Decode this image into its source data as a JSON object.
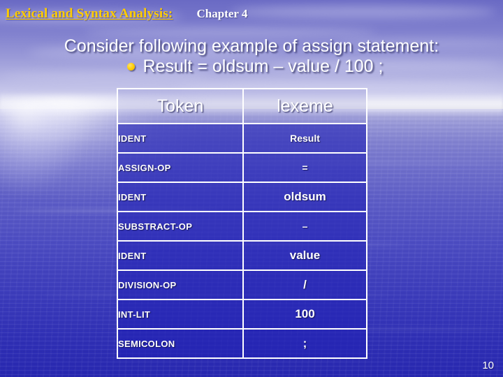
{
  "slide": {
    "header": {
      "title": "Lexical and Syntax Analysis:",
      "chapter": "Chapter 4"
    },
    "subtitle": "Consider following example of assign statement:",
    "bullet": {
      "icon": "bullet-dot-icon",
      "text": "Result = oldsum – value / 100 ;"
    },
    "table": {
      "columns": [
        "Token",
        "lexeme"
      ],
      "rows": [
        {
          "token": "IDENT",
          "lexeme": "Result",
          "lexeme_large": false
        },
        {
          "token": "ASSIGN-OP",
          "lexeme": "=",
          "lexeme_large": false
        },
        {
          "token": "IDENT",
          "lexeme": "oldsum",
          "lexeme_large": true
        },
        {
          "token": "SUBSTRACT-OP",
          "lexeme": "–",
          "lexeme_large": false
        },
        {
          "token": "IDENT",
          "lexeme": "value",
          "lexeme_large": true
        },
        {
          "token": "DIVISION-OP",
          "lexeme": "/",
          "lexeme_large": true
        },
        {
          "token": "INT-LIT",
          "lexeme": "100",
          "lexeme_large": true
        },
        {
          "token": "SEMICOLON",
          "lexeme": ";",
          "lexeme_large": true
        }
      ]
    },
    "page_number": "10",
    "colors": {
      "title_gold": "#ffcc00",
      "body_text": "#ffffff",
      "table_fill": "#2222b4",
      "table_border": "#ffffff",
      "water_deep": "#2828b0",
      "sky_light": "#cfcfee"
    }
  }
}
